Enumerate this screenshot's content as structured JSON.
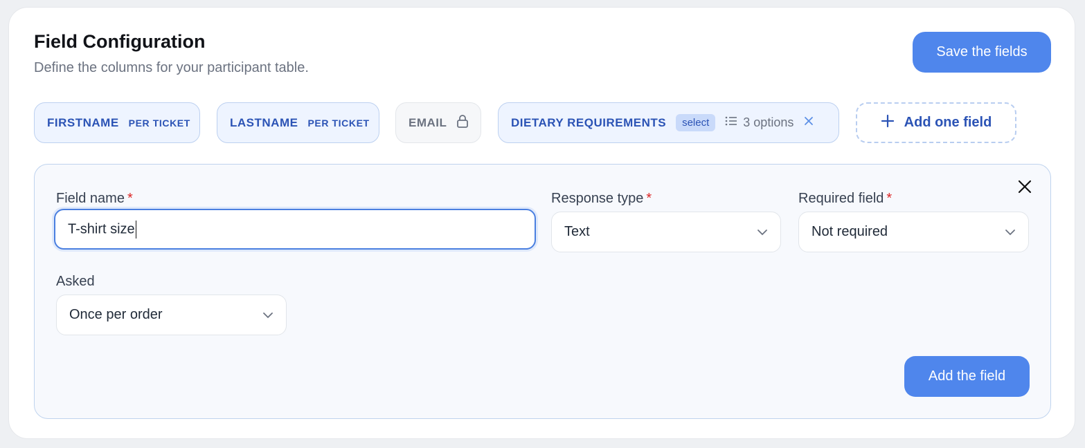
{
  "header": {
    "title": "Field Configuration",
    "subtitle": "Define the columns for your participant table.",
    "save_label": "Save the fields"
  },
  "chips": [
    {
      "name": "FIRSTNAME",
      "tag": "PER TICKET"
    },
    {
      "name": "LASTNAME",
      "tag": "PER TICKET"
    },
    {
      "name": "EMAIL",
      "icon": "lock-icon"
    },
    {
      "name": "DIETARY REQUIREMENTS",
      "badge": "select",
      "options_label": "3 options",
      "icon": "close-icon"
    }
  ],
  "add_chip": {
    "label": "Add one field",
    "icon": "plus-icon"
  },
  "form": {
    "field_name": {
      "label": "Field name",
      "required_mark": "*",
      "value": "T-shirt size"
    },
    "response_type": {
      "label": "Response type",
      "required_mark": "*",
      "value": "Text"
    },
    "required_field": {
      "label": "Required field",
      "required_mark": "*",
      "value": "Not required"
    },
    "asked": {
      "label": "Asked",
      "value": "Once per order"
    },
    "add_label": "Add the field"
  },
  "colors": {
    "primary": "#4f86ec",
    "chip_text": "#2b53b5",
    "required": "#dc2626"
  }
}
